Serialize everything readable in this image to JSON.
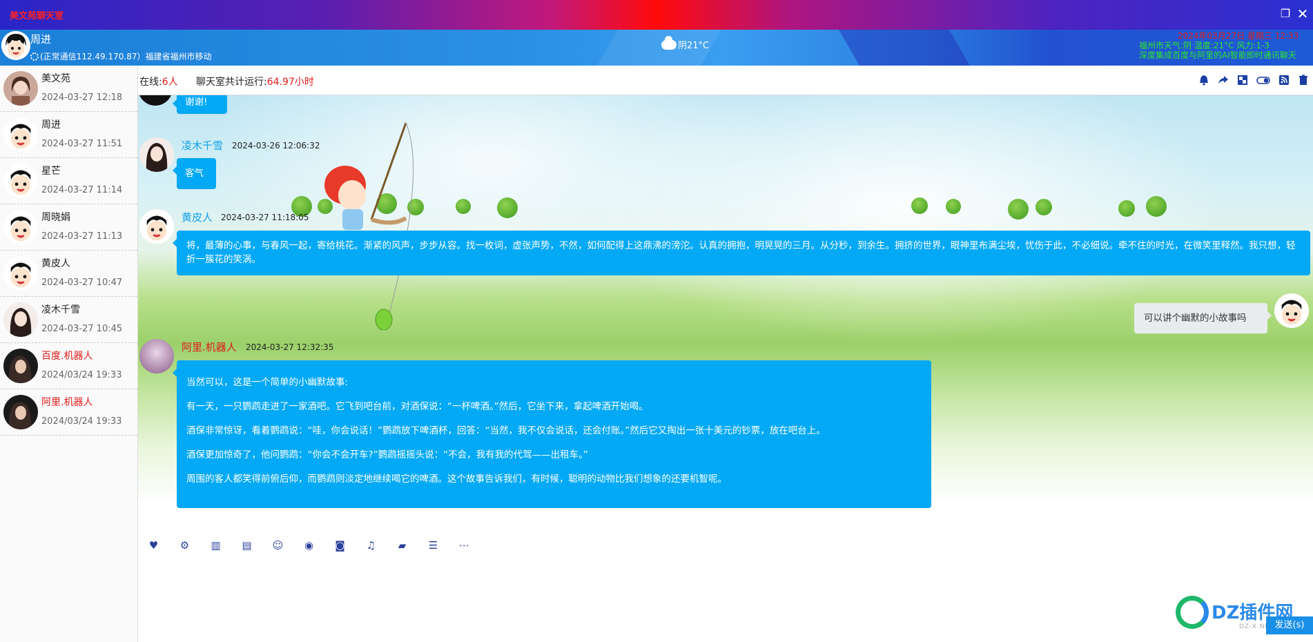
{
  "window": {
    "title": "美文苑聊天室"
  },
  "header": {
    "user_name": "周进",
    "status": "(正常通信112.49.170.87）福建省福州市移动",
    "weather": "阴21°C",
    "right_line1": "2024年03月27日 星期三 12:33",
    "right_line2": "福州市天气:阴 温度:21°C 风力:1-3",
    "right_line3": "深度集成百度与阿里的AI智能即时通讯聊天"
  },
  "sidebar": {
    "contacts": [
      {
        "name": "美文苑",
        "time": "2024-03-27 12:18",
        "robot": false
      },
      {
        "name": "周进",
        "time": "2024-03-27 11:51",
        "robot": false
      },
      {
        "name": "星芒",
        "time": "2024-03-27 11:14",
        "robot": false
      },
      {
        "name": "周晓娟",
        "time": "2024-03-27 11:13",
        "robot": false
      },
      {
        "name": "黄皮人",
        "time": "2024-03-27 10:47",
        "robot": false
      },
      {
        "name": "凌木千雪",
        "time": "2024-03-27 10:45",
        "robot": false
      },
      {
        "name": "百度.机器人",
        "time": "2024/03/24 19:33",
        "robot": true
      },
      {
        "name": "阿里.机器人",
        "time": "2024/03/24 19:33",
        "robot": true
      }
    ]
  },
  "topbar": {
    "online_label": "在线:",
    "online_count": "6人",
    "runtime_label": "聊天室共计运行:",
    "runtime_value": "64.97小时"
  },
  "messages": {
    "m0": {
      "text": "谢谢!"
    },
    "m1": {
      "name": "凌木千雪",
      "time": "2024-03-26 12:06:32",
      "text": "客气"
    },
    "m2": {
      "name": "黄皮人",
      "time": "2024-03-27 11:18:05",
      "text": "将，最薄的心事，与春风一起，寄给桃花。渐紧的风声，步步从容。找一枚词，虚张声势，不然，如何配得上这鼎沸的滂沱。认真的拥抱，明晃晃的三月。从分秒，到余生。拥挤的世界，眼神里布满尘埃，忧伤于此，不必细说。牵不住的时光，在微笑里释然。我只想，轻折一簇花的笑涡。"
    },
    "m3": {
      "text": "可以讲个幽默的小故事吗"
    },
    "m4": {
      "name": "阿里.机器人",
      "time": "2024-03-27 12:32:35",
      "p1": "当然可以，这是一个简单的小幽默故事:",
      "p2": "有一天，一只鹦鹉走进了一家酒吧。它飞到吧台前，对酒保说：“一杯啤酒。”然后，它坐下来，拿起啤酒开始喝。",
      "p3": "酒保非常惊讶，看着鹦鹉说：“哇，你会说话！”鹦鹉放下啤酒杯，回答：“当然，我不仅会说话，还会付账。”然后它又掏出一张十美元的钞票，放在吧台上。",
      "p4": "酒保更加惊奇了，他问鹦鹉：“你会不会开车?”鹦鹉摇摇头说：“不会，我有我的代驾——出租车。”",
      "p5": "周围的客人都笑得前俯后仰，而鹦鹉则淡定地继续喝它的啤酒。这个故事告诉我们，有时候，聪明的动物比我们想象的还要机智呢。"
    }
  },
  "input": {
    "send_label": "发送(s)",
    "watermark": "DZ插件网",
    "watermark_sub": "DZ-X.NET"
  },
  "icons": {
    "top": [
      "bell-icon",
      "share-icon",
      "window-icon",
      "toggle-icon",
      "rss-icon",
      "trash-icon"
    ],
    "tools": [
      "heart-icon",
      "gear-icon",
      "map-icon",
      "id-card-icon",
      "smile-icon",
      "user-circle-icon",
      "camera-icon",
      "music-icon",
      "folder-icon",
      "server-icon",
      "more-icon"
    ]
  },
  "colors": {
    "accent": "#03a9f4",
    "robot_name": "#e01b1b",
    "header": "#2b8fe4"
  }
}
